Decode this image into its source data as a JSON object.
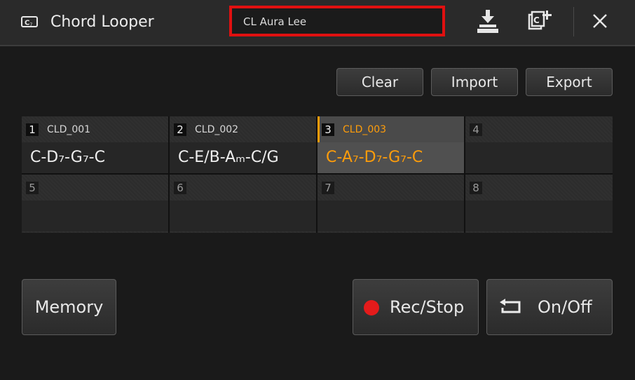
{
  "app": {
    "title": "Chord Looper",
    "icon": "chord-looper-icon"
  },
  "song": {
    "name": "CL Aura Lee",
    "highlight_color": "#e01010"
  },
  "toolbar": {
    "save_icon": "save-download-icon",
    "new_icon": "new-chord-icon",
    "close_icon": "close-icon"
  },
  "actions": {
    "clear": "Clear",
    "import": "Import",
    "export": "Export"
  },
  "slots": [
    {
      "number": "1",
      "name": "CLD_001",
      "chords": "C-D₇-G₇-C",
      "selected": false
    },
    {
      "number": "2",
      "name": "CLD_002",
      "chords": "C-E/B-Aₘ-C/G",
      "selected": false
    },
    {
      "number": "3",
      "name": "CLD_003",
      "chords": "C-A₇-D₇-G₇-C",
      "selected": true
    },
    {
      "number": "4",
      "name": "",
      "chords": "",
      "selected": false
    },
    {
      "number": "5",
      "name": "",
      "chords": "",
      "selected": false
    },
    {
      "number": "6",
      "name": "",
      "chords": "",
      "selected": false
    },
    {
      "number": "7",
      "name": "",
      "chords": "",
      "selected": false
    },
    {
      "number": "8",
      "name": "",
      "chords": "",
      "selected": false
    }
  ],
  "selected_color": "#ff9d0a",
  "bottom": {
    "memory": "Memory",
    "rec_stop": "Rec/Stop",
    "on_off": "On/Off",
    "rec_icon": "record-dot-icon",
    "loop_icon": "loop-icon",
    "rec_color": "#e41b1b"
  }
}
